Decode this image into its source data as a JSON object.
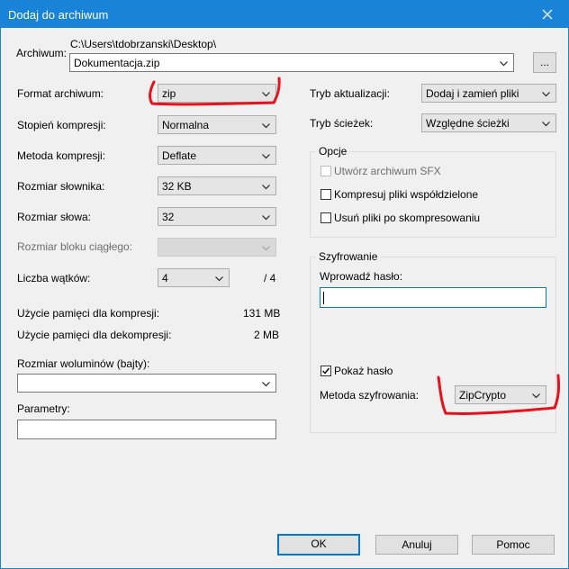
{
  "window": {
    "title": "Dodaj do archiwum"
  },
  "archive": {
    "label": "Archiwum:",
    "path": "C:\\Users\\tdobrzanski\\Desktop\\",
    "filename": "Dokumentacja.zip",
    "browse_label": "..."
  },
  "left": {
    "format_label": "Format archiwum:",
    "format_value": "zip",
    "level_label": "Stopień kompresji:",
    "level_value": "Normalna",
    "method_label": "Metoda kompresji:",
    "method_value": "Deflate",
    "dict_label": "Rozmiar słownika:",
    "dict_value": "32 KB",
    "word_label": "Rozmiar słowa:",
    "word_value": "32",
    "block_label": "Rozmiar bloku ciągłego:",
    "block_value": "",
    "threads_label": "Liczba wątków:",
    "threads_value": "4",
    "threads_max": "/ 4",
    "mem_comp_label": "Użycie pamięci dla kompresji:",
    "mem_comp_value": "131 MB",
    "mem_decomp_label": "Użycie pamięci dla dekompresji:",
    "mem_decomp_value": "2 MB",
    "volume_label": "Rozmiar woluminów (bajty):",
    "volume_value": "",
    "params_label": "Parametry:",
    "params_value": ""
  },
  "right": {
    "update_label": "Tryb aktualizacji:",
    "update_value": "Dodaj i zamień pliki",
    "paths_label": "Tryb ścieżek:",
    "paths_value": "Względne ścieżki",
    "options_title": "Opcje",
    "opt_sfx": "Utwórz archiwum SFX",
    "opt_shared": "Kompresuj pliki współdzielone",
    "opt_delete": "Usuń pliki po skompresowaniu",
    "enc_title": "Szyfrowanie",
    "enc_pw_label": "Wprowadź hasło:",
    "enc_pw_value": "",
    "enc_show": "Pokaż hasło",
    "enc_method_label": "Metoda szyfrowania:",
    "enc_method_value": "ZipCrypto"
  },
  "buttons": {
    "ok": "OK",
    "cancel": "Anuluj",
    "help": "Pomoc"
  },
  "colors": {
    "titlebar": "#1883d7",
    "annotation": "#e8101a"
  },
  "icons": {
    "close": "close-icon",
    "dropdown": "chevron-down-icon",
    "check": "checkmark-icon"
  }
}
